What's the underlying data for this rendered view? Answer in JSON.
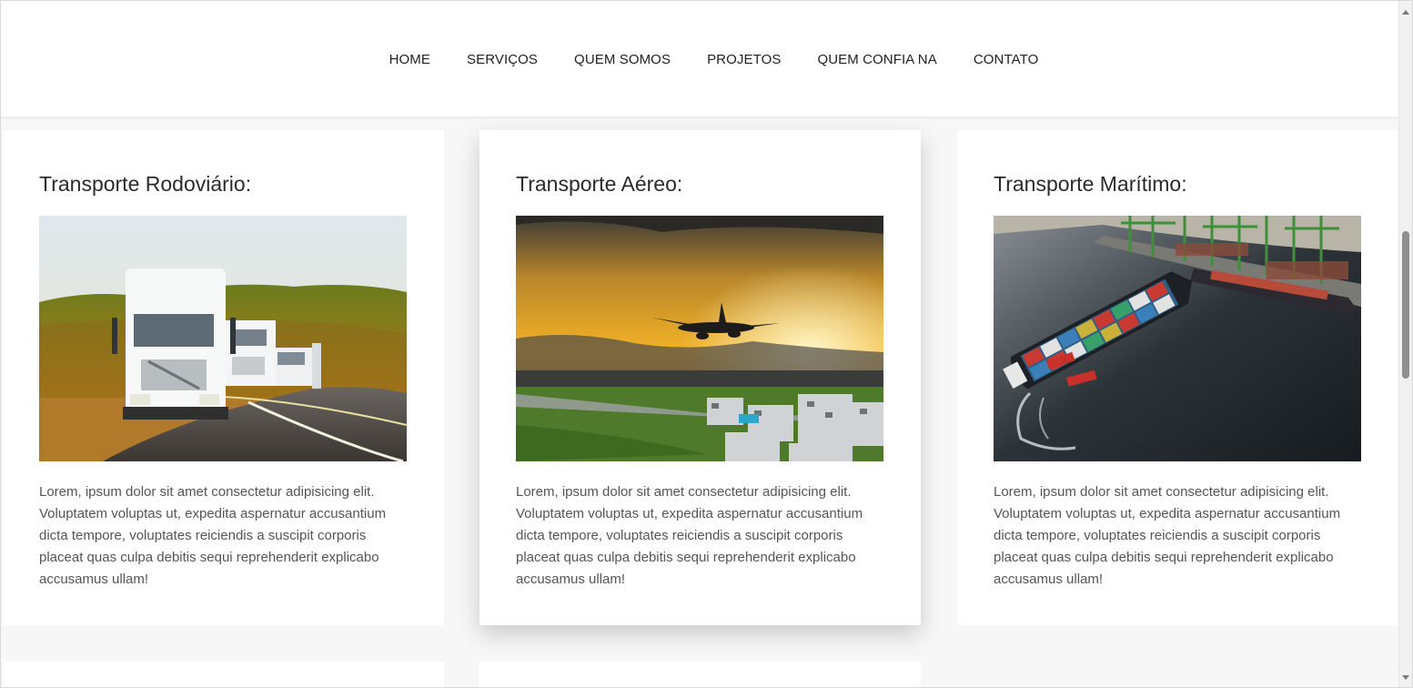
{
  "nav": {
    "items": [
      {
        "label": "HOME"
      },
      {
        "label": "SERVIÇOS"
      },
      {
        "label": "QUEM SOMOS"
      },
      {
        "label": "PROJETOS"
      },
      {
        "label": "QUEM CONFIA NA"
      },
      {
        "label": "CONTATO"
      }
    ]
  },
  "cards": [
    {
      "title": "Transporte Rodoviário:",
      "image_icon": "truck-image",
      "text": "Lorem, ipsum dolor sit amet consectetur adipisicing elit. Voluptatem voluptas ut, expedita aspernatur accusantium dicta tempore, voluptates reiciendis a suscipit corporis placeat quas culpa debitis sequi reprehenderit explicabo accusamus ullam!"
    },
    {
      "title": "Transporte Aéreo:",
      "image_icon": "airplane-image",
      "text": "Lorem, ipsum dolor sit amet consectetur adipisicing elit. Voluptatem voluptas ut, expedita aspernatur accusantium dicta tempore, voluptates reiciendis a suscipit corporis placeat quas culpa debitis sequi reprehenderit explicabo accusamus ullam!"
    },
    {
      "title": "Transporte Marítimo:",
      "image_icon": "ship-image",
      "text": "Lorem, ipsum dolor sit amet consectetur adipisicing elit. Voluptatem voluptas ut, expedita aspernatur accusantium dicta tempore, voluptates reiciendis a suscipit corporis placeat quas culpa debitis sequi reprehenderit explicabo accusamus ullam!"
    }
  ],
  "colors": {
    "page_bg": "#f7f7f7",
    "card_bg": "#ffffff",
    "nav_text": "#222222",
    "body_text": "#555555"
  }
}
